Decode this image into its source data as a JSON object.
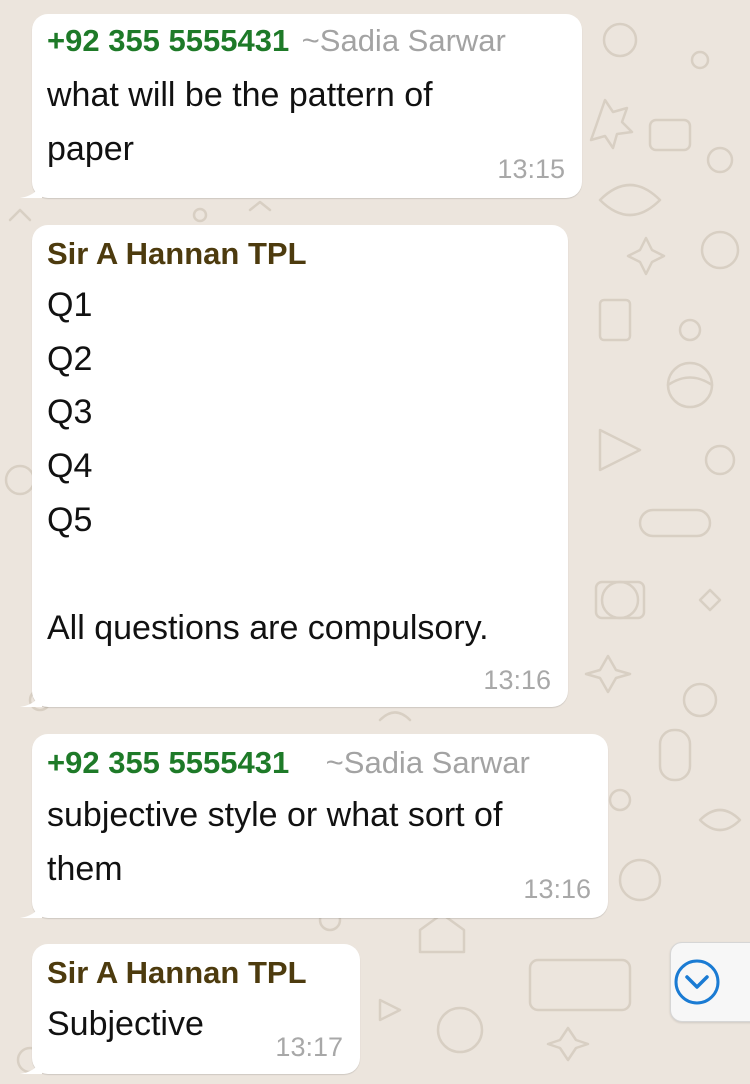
{
  "colors": {
    "background": "#ECE5DD",
    "bubble": "#FFFFFF",
    "phone_sender": "#1E7A28",
    "named_sender": "#4D3B0E",
    "pushname": "#A3A3A3",
    "timestamp": "#A8A8A8",
    "accent": "#1A7BD3"
  },
  "messages": [
    {
      "sender": "+92 355 5555431",
      "pushname": "~Sadia Sarwar",
      "lines": [
        "what will be the pattern of",
        "paper"
      ],
      "time": "13:15"
    },
    {
      "sender": "Sir A Hannan TPL",
      "lines": [
        "Q1",
        "Q2",
        "Q3",
        "Q4",
        "Q5",
        "",
        "All questions are compulsory."
      ],
      "time": "13:16"
    },
    {
      "sender": "+92 355 5555431",
      "pushname": "~Sadia Sarwar",
      "lines": [
        "subjective style or what sort of",
        "them"
      ],
      "time": "13:16"
    },
    {
      "sender": "Sir A Hannan TPL",
      "lines": [
        "Subjective"
      ],
      "time": "13:17"
    }
  ],
  "scroll_button": {
    "icon": "chevron-down-circle-icon"
  }
}
